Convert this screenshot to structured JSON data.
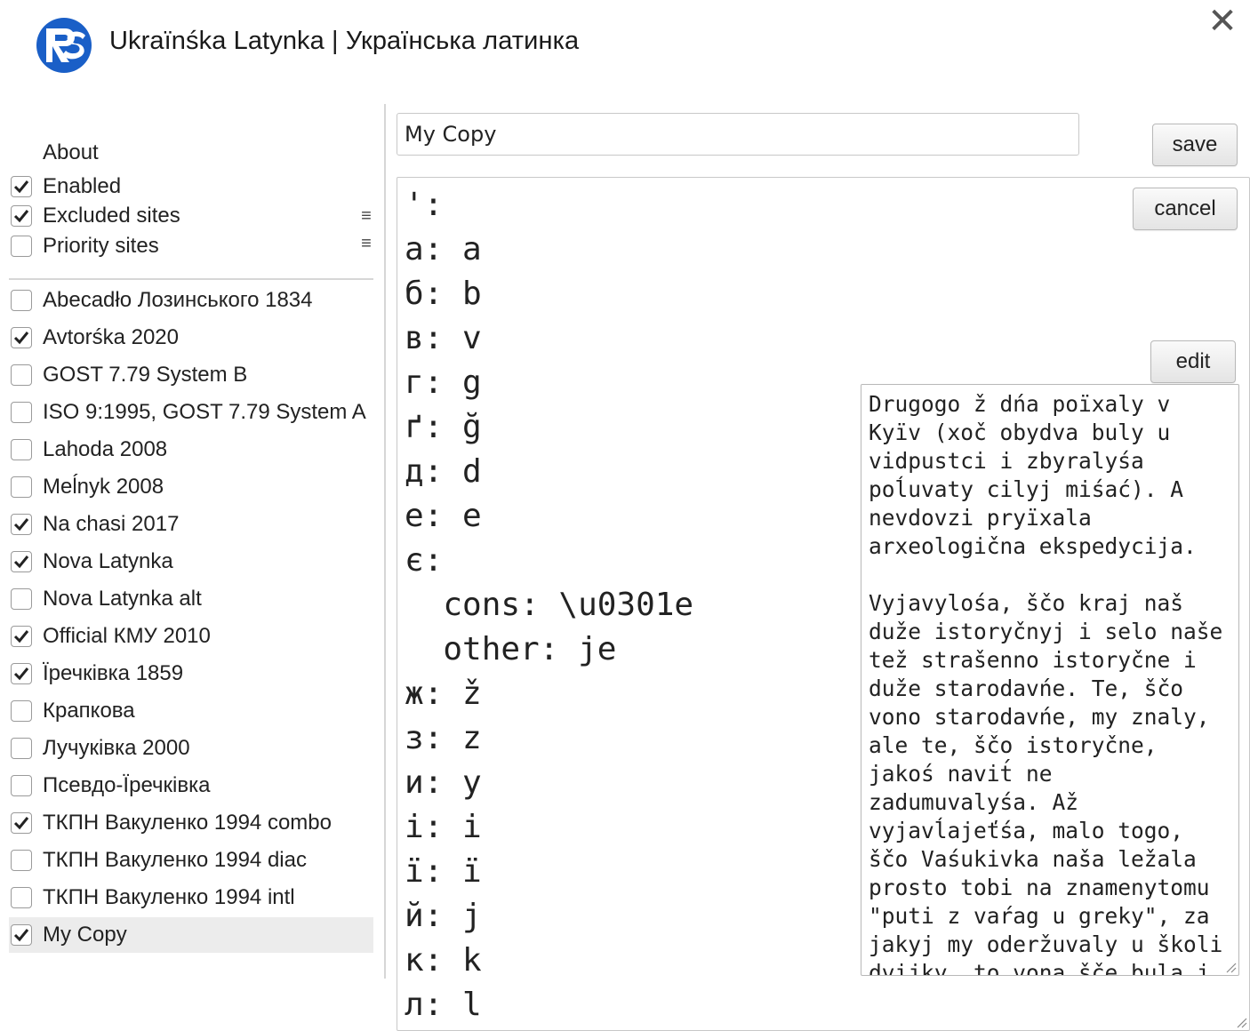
{
  "header": {
    "title": "Ukraïnśka Latynka | Українська латинка",
    "close_symbol": "✕",
    "logo_icon": "rs-logo-icon",
    "brand_color": "#1a5fc7"
  },
  "sidebar": {
    "about_label": "About",
    "settings": [
      {
        "label": "Enabled",
        "checked": true
      },
      {
        "label": "Excluded sites",
        "checked": true,
        "menu": "≡"
      },
      {
        "label": "Priority sites",
        "checked": false,
        "menu": "≡"
      }
    ],
    "schemes": [
      {
        "label": "Abecadło Лозинського 1834",
        "checked": false
      },
      {
        "label": "Avtorśka 2020",
        "checked": true
      },
      {
        "label": "GOST 7.79 System B",
        "checked": false
      },
      {
        "label": "ISO 9:1995, GOST 7.79 System A",
        "checked": false
      },
      {
        "label": "Lahoda 2008",
        "checked": false
      },
      {
        "label": "Meĺnyk 2008",
        "checked": false
      },
      {
        "label": "Na chasi 2017",
        "checked": true
      },
      {
        "label": "Nova Latynka",
        "checked": true
      },
      {
        "label": "Nova Latynka alt",
        "checked": false
      },
      {
        "label": "Official КМУ 2010",
        "checked": true
      },
      {
        "label": "Їречківка 1859",
        "checked": true
      },
      {
        "label": "Крапкова",
        "checked": false
      },
      {
        "label": "Лучуківка 2000",
        "checked": false
      },
      {
        "label": "Псевдо-Їречківка",
        "checked": false
      },
      {
        "label": "ТКПН Вакуленко 1994 combo",
        "checked": true
      },
      {
        "label": "ТКПН Вакуленко 1994 diac",
        "checked": false
      },
      {
        "label": "ТКПН Вакуленко 1994 intl",
        "checked": false
      },
      {
        "label": "My Copy",
        "checked": true,
        "selected": true
      }
    ]
  },
  "editor": {
    "name_value": "My Copy",
    "save_label": "save",
    "cancel_label": "cancel",
    "edit_label": "edit",
    "mapping_lines": [
      "':",
      "а: a",
      "б: b",
      "в: v",
      "г: g",
      "ґ: ğ",
      "д: d",
      "е: e",
      "є:",
      "  cons: \\u0301e",
      "  other: je",
      "ж: ž",
      "з: z",
      "и: y",
      "і: i",
      "ї: ï",
      "й: j",
      "к: k",
      "л: l"
    ],
    "sample_text": "Drugogo ž dńa poïxaly v Kyïv (xoč obydva buly u vidpustci i zbyralyśa poĺuvaty cilyj miśać). A nevdovzi pryïxala arxeologična ekspedycija.\n\nVyjavylośa, ščo kraj naš duže istoryčnyj i selo naše tež strašenno istoryčne i duže starodavńe. Te, ščo vono starodavńe, my znaly, ale te, ščo istoryčne, jakoś navit́ ne zadumuvalyśa. Až vyjavĺajeťśa, malo togo, ščo Vaśukivka naša ležala prosto tobi na znamenytomu \"puti z vaŕag u greky\", za jakyj my oderžuvaly u školi dvijky, to vona šče bula j na samisińkomu perexresti poxodiv slavnyx zaporožciv"
  }
}
